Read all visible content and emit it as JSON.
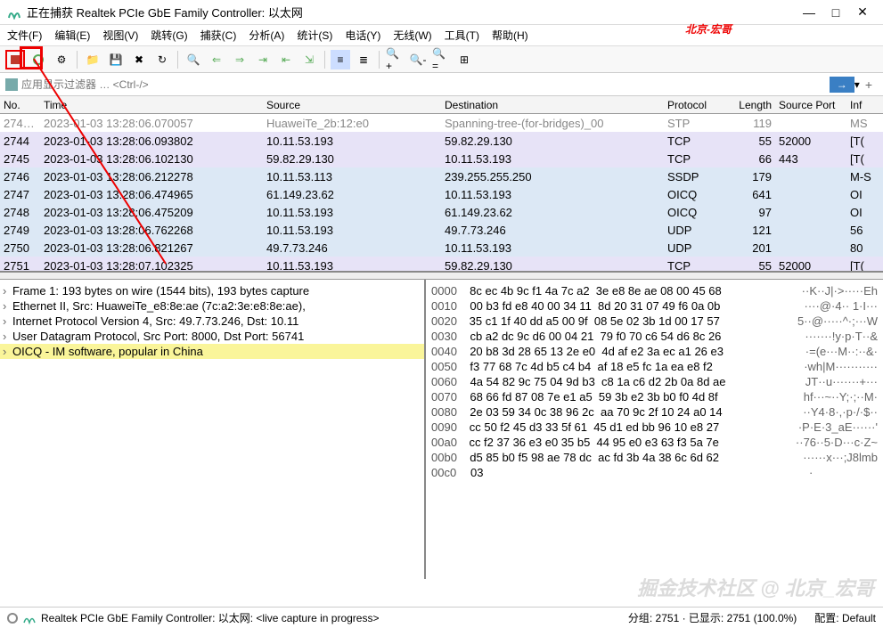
{
  "window": {
    "title": "正在捕获 Realtek PCIe GbE Family Controller: 以太网",
    "min": "—",
    "max": "□",
    "close": "✕"
  },
  "menu": {
    "file": "文件(F)",
    "edit": "编辑(E)",
    "view": "视图(V)",
    "go": "跳转(G)",
    "capture": "捕获(C)",
    "analyze": "分析(A)",
    "stats": "统计(S)",
    "tel": "电话(Y)",
    "wireless": "无线(W)",
    "tools": "工具(T)",
    "help": "帮助(H)"
  },
  "annotation": "北京-宏哥",
  "filter": {
    "placeholder": "应用显示过滤器 … <Ctrl-/>",
    "arrow": "→",
    "plus": "+"
  },
  "columns": {
    "no": "No.",
    "time": "Time",
    "src": "Source",
    "dst": "Destination",
    "proto": "Protocol",
    "len": "Length",
    "port": "Source Port",
    "info": "Inf"
  },
  "rows": [
    {
      "cls": "stp",
      "no": "274…",
      "time": "2023-01-03 13:28:06.070057",
      "src": "HuaweiTe_2b:12:e0",
      "dst": "Spanning-tree-(for-bridges)_00",
      "proto": "STP",
      "len": "119",
      "port": "",
      "info": "MS"
    },
    {
      "cls": "tcp",
      "no": "2744",
      "time": "2023-01-03 13:28:06.093802",
      "src": "10.11.53.193",
      "dst": "59.82.29.130",
      "proto": "TCP",
      "len": "55",
      "port": "52000",
      "info": "[T("
    },
    {
      "cls": "tcp",
      "no": "2745",
      "time": "2023-01-03 13:28:06.102130",
      "src": "59.82.29.130",
      "dst": "10.11.53.193",
      "proto": "TCP",
      "len": "66",
      "port": "443",
      "info": "[T("
    },
    {
      "cls": "ssdp",
      "no": "2746",
      "time": "2023-01-03 13:28:06.212278",
      "src": "10.11.53.113",
      "dst": "239.255.255.250",
      "proto": "SSDP",
      "len": "179",
      "port": "",
      "info": "M-S"
    },
    {
      "cls": "oicq",
      "no": "2747",
      "time": "2023-01-03 13:28:06.474965",
      "src": "61.149.23.62",
      "dst": "10.11.53.193",
      "proto": "OICQ",
      "len": "641",
      "port": "",
      "info": "OI"
    },
    {
      "cls": "oicq",
      "no": "2748",
      "time": "2023-01-03 13:28:06.475209",
      "src": "10.11.53.193",
      "dst": "61.149.23.62",
      "proto": "OICQ",
      "len": "97",
      "port": "",
      "info": "OI"
    },
    {
      "cls": "udp",
      "no": "2749",
      "time": "2023-01-03 13:28:06.762268",
      "src": "10.11.53.193",
      "dst": "49.7.73.246",
      "proto": "UDP",
      "len": "121",
      "port": "",
      "info": "56"
    },
    {
      "cls": "udp",
      "no": "2750",
      "time": "2023-01-03 13:28:06.821267",
      "src": "49.7.73.246",
      "dst": "10.11.53.193",
      "proto": "UDP",
      "len": "201",
      "port": "",
      "info": "80"
    },
    {
      "cls": "tcp",
      "no": "2751",
      "time": "2023-01-03 13:28:07.102325",
      "src": "10.11.53.193",
      "dst": "59.82.29.130",
      "proto": "TCP",
      "len": "55",
      "port": "52000",
      "info": "[T("
    }
  ],
  "tree": [
    {
      "t": "Frame 1: 193 bytes on wire (1544 bits), 193 bytes capture",
      "hl": false
    },
    {
      "t": "Ethernet II, Src: HuaweiTe_e8:8e:ae (7c:a2:3e:e8:8e:ae),",
      "hl": false
    },
    {
      "t": "Internet Protocol Version 4, Src: 49.7.73.246, Dst: 10.11",
      "hl": false
    },
    {
      "t": "User Datagram Protocol, Src Port: 8000, Dst Port: 56741",
      "hl": false
    },
    {
      "t": "OICQ - IM software, popular in China",
      "hl": true
    }
  ],
  "hex": [
    {
      "o": "0000",
      "b": "8c ec 4b 9c f1 4a 7c a2  3e e8 8e ae 08 00 45 68",
      "a": "··K··J|·>·····Eh"
    },
    {
      "o": "0010",
      "b": "00 b3 fd e8 40 00 34 11  8d 20 31 07 49 f6 0a 0b",
      "a": "····@·4·· 1·I···"
    },
    {
      "o": "0020",
      "b": "35 c1 1f 40 dd a5 00 9f  08 5e 02 3b 1d 00 17 57",
      "a": "5··@·····^·;···W"
    },
    {
      "o": "0030",
      "b": "cb a2 dc 9c d6 00 04 21  79 f0 70 c6 54 d6 8c 26",
      "a": "·······!y·p·T··&"
    },
    {
      "o": "0040",
      "b": "20 b8 3d 28 65 13 2e e0  4d af e2 3a ec a1 26 e3",
      "a": " ·=(e···M··:··&·"
    },
    {
      "o": "0050",
      "b": "f3 77 68 7c 4d b5 c4 b4  af 18 e5 fc 1a ea e8 f2",
      "a": "·wh|M···········"
    },
    {
      "o": "0060",
      "b": "4a 54 82 9c 75 04 9d b3  c8 1a c6 d2 2b 0a 8d ae",
      "a": "JT··u·······+···"
    },
    {
      "o": "0070",
      "b": "68 66 fd 87 08 7e e1 a5  59 3b e2 3b b0 f0 4d 8f",
      "a": "hf···~··Y;·;··M·"
    },
    {
      "o": "0080",
      "b": "2e 03 59 34 0c 38 96 2c  aa 70 9c 2f 10 24 a0 14",
      "a": "··Y4·8·,·p·/·$··"
    },
    {
      "o": "0090",
      "b": "cc 50 f2 45 d3 33 5f 61  45 d1 ed bb 96 10 e8 27",
      "a": "·P·E·3_aE······'"
    },
    {
      "o": "00a0",
      "b": "cc f2 37 36 e3 e0 35 b5  44 95 e0 e3 63 f3 5a 7e",
      "a": "··76··5·D···c·Z~"
    },
    {
      "o": "00b0",
      "b": "d5 85 b0 f5 98 ae 78 dc  ac fd 3b 4a 38 6c 6d 62",
      "a": "······x···;J8lmb"
    },
    {
      "o": "00c0",
      "b": "03                                              ",
      "a": "·"
    }
  ],
  "status": {
    "iface": "Realtek PCIe GbE Family Controller: 以太网: <live capture in progress>",
    "counts": "分组: 2751 · 已显示: 2751 (100.0%)",
    "profile": "配置: Default"
  },
  "watermark": "掘金技术社区 @ 北京_宏哥"
}
